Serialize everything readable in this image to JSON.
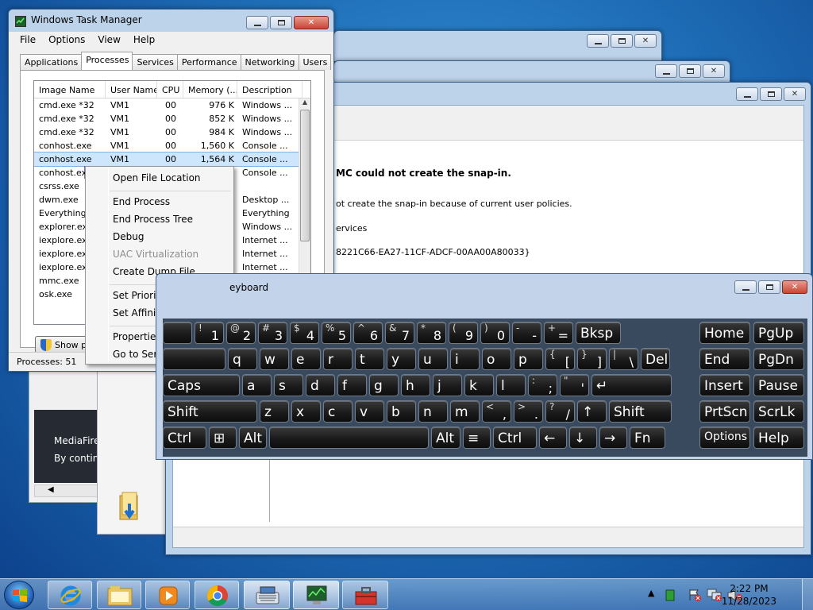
{
  "taskmgr": {
    "title": "Windows Task Manager",
    "menu": [
      "File",
      "Options",
      "View",
      "Help"
    ],
    "tabs": [
      "Applications",
      "Processes",
      "Services",
      "Performance",
      "Networking",
      "Users"
    ],
    "columns": [
      "Image Name",
      "User Name",
      "CPU",
      "Memory (...",
      "Description"
    ],
    "rows": [
      {
        "image": "cmd.exe *32",
        "user": "VM1",
        "cpu": "00",
        "mem": "976 K",
        "desc": "Windows ..."
      },
      {
        "image": "cmd.exe *32",
        "user": "VM1",
        "cpu": "00",
        "mem": "852 K",
        "desc": "Windows ..."
      },
      {
        "image": "cmd.exe *32",
        "user": "VM1",
        "cpu": "00",
        "mem": "984 K",
        "desc": "Windows ..."
      },
      {
        "image": "conhost.exe",
        "user": "VM1",
        "cpu": "00",
        "mem": "1,560 K",
        "desc": "Console ..."
      },
      {
        "image": "conhost.exe",
        "user": "VM1",
        "cpu": "00",
        "mem": "1,564 K",
        "desc": "Console ..."
      },
      {
        "image": "conhost.exe",
        "user": "",
        "cpu": "",
        "mem": "",
        "desc": "Console ..."
      },
      {
        "image": "csrss.exe",
        "user": "",
        "cpu": "",
        "mem": "",
        "desc": ""
      },
      {
        "image": "dwm.exe",
        "user": "",
        "cpu": "",
        "mem": "",
        "desc": "Desktop ..."
      },
      {
        "image": "Everything.e",
        "user": "",
        "cpu": "",
        "mem": "",
        "desc": "Everything"
      },
      {
        "image": "explorer.exe",
        "user": "",
        "cpu": "",
        "mem": "",
        "desc": "Windows ..."
      },
      {
        "image": "iexplore.exe",
        "user": "",
        "cpu": "",
        "mem": "",
        "desc": "Internet ..."
      },
      {
        "image": "iexplore.exe",
        "user": "",
        "cpu": "",
        "mem": "",
        "desc": "Internet ..."
      },
      {
        "image": "iexplore.exe",
        "user": "",
        "cpu": "",
        "mem": "",
        "desc": "Internet ..."
      },
      {
        "image": "mmc.exe",
        "user": "",
        "cpu": "",
        "mem": "",
        "desc": ""
      },
      {
        "image": "osk.exe",
        "user": "",
        "cpu": "",
        "mem": "",
        "desc": ""
      }
    ],
    "show_button": "Show pr",
    "status": "Processes: 51"
  },
  "context_menu": {
    "items": [
      {
        "label": "Open File Location",
        "disabled": false
      },
      {
        "label": "End Process",
        "disabled": false
      },
      {
        "label": "End Process Tree",
        "disabled": false
      },
      {
        "label": "Debug",
        "disabled": false
      },
      {
        "label": "UAC Virtualization",
        "disabled": true
      },
      {
        "label": "Create Dump File",
        "disabled": false
      },
      {
        "label": "Set Priority",
        "disabled": false
      },
      {
        "label": "Set Affinity...",
        "disabled": false
      },
      {
        "label": "Properties",
        "disabled": false
      },
      {
        "label": "Go to Service(s)",
        "disabled": false
      }
    ]
  },
  "mmc": {
    "error_title": "MC could not create the snap-in.",
    "error_body": "ot create the snap-in because of current user policies.",
    "name_line": "ervices",
    "clsid": "8221C66-EA27-11CF-ADCF-00AA00A80033}"
  },
  "mediafire": {
    "line1": "MediaFire",
    "line2": "By contin"
  },
  "osk": {
    "title": "eyboard",
    "rows": [
      [
        [
          "",
          ""
        ],
        [
          "!",
          "1"
        ],
        [
          "@",
          "2"
        ],
        [
          "#",
          "3"
        ],
        [
          "$",
          "4"
        ],
        [
          "%",
          "5"
        ],
        [
          "^",
          "6"
        ],
        [
          "&",
          "7"
        ],
        [
          "*",
          "8"
        ],
        [
          "(",
          "9"
        ],
        [
          ")",
          "0"
        ],
        [
          "-",
          "-"
        ],
        [
          "+",
          "="
        ],
        [
          "",
          "Bksp"
        ]
      ],
      [
        [
          "",
          ""
        ],
        [
          "",
          "q"
        ],
        [
          "",
          "w"
        ],
        [
          "",
          "e"
        ],
        [
          "",
          "r"
        ],
        [
          "",
          "t"
        ],
        [
          "",
          "y"
        ],
        [
          "",
          "u"
        ],
        [
          "",
          "i"
        ],
        [
          "",
          "o"
        ],
        [
          "",
          "p"
        ],
        [
          "{",
          "["
        ],
        [
          "}",
          "]"
        ],
        [
          "|",
          "\\"
        ],
        [
          "",
          "Del"
        ]
      ],
      [
        [
          "",
          "Caps"
        ],
        [
          "",
          "a"
        ],
        [
          "",
          "s"
        ],
        [
          "",
          "d"
        ],
        [
          "",
          "f"
        ],
        [
          "",
          "g"
        ],
        [
          "",
          "h"
        ],
        [
          "",
          "j"
        ],
        [
          "",
          "k"
        ],
        [
          "",
          "l"
        ],
        [
          ":",
          ";"
        ],
        [
          "\"",
          "'"
        ],
        [
          "",
          "↵"
        ]
      ],
      [
        [
          "",
          "Shift"
        ],
        [
          "",
          "z"
        ],
        [
          "",
          "x"
        ],
        [
          "",
          "c"
        ],
        [
          "",
          "v"
        ],
        [
          "",
          "b"
        ],
        [
          "",
          "n"
        ],
        [
          "",
          "m"
        ],
        [
          "<",
          ","
        ],
        [
          ">",
          "."
        ],
        [
          "?",
          "/"
        ],
        [
          "",
          "↑"
        ],
        [
          "",
          "Shift"
        ]
      ],
      [
        [
          "",
          "Ctrl"
        ],
        [
          "",
          "⊞"
        ],
        [
          "",
          "Alt"
        ],
        [
          "",
          ""
        ],
        [
          "",
          "Alt"
        ],
        [
          "",
          "≡"
        ],
        [
          "",
          "Ctrl"
        ],
        [
          "",
          "←"
        ],
        [
          "",
          "↓"
        ],
        [
          "",
          "→"
        ],
        [
          "",
          "Fn"
        ]
      ]
    ],
    "nav": [
      [
        "Home",
        "PgUp"
      ],
      [
        "End",
        "PgDn"
      ],
      [
        "Insert",
        "Pause"
      ],
      [
        "PrtScn",
        "ScrLk"
      ],
      [
        "Options",
        "Help"
      ]
    ]
  },
  "taskbar": {
    "time": "2:22 PM",
    "date": "11/28/2023",
    "tray_arrow": "▲"
  }
}
